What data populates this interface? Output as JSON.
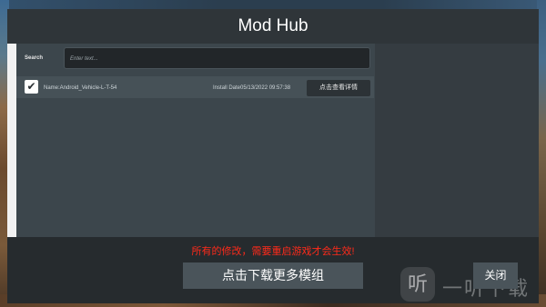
{
  "window": {
    "title": "Mod Hub"
  },
  "search": {
    "label": "Search",
    "placeholder": "Enter text..."
  },
  "mods": [
    {
      "checked": true,
      "name": "Name:Android_Vehicle-L-T-54",
      "install_date": "Install Date05/13/2022 09:57:38",
      "details_label": "点击查看详情"
    }
  ],
  "footer": {
    "notice": "所有的修改，需要重启游戏才会生效!",
    "download_label": "点击下载更多模组",
    "close_label": "关闭"
  },
  "watermark": {
    "logo": "听",
    "text": "一听下载"
  },
  "colors": {
    "notice": "#ff2a1a",
    "panel": "#3c464c",
    "button": "#4a545a"
  }
}
